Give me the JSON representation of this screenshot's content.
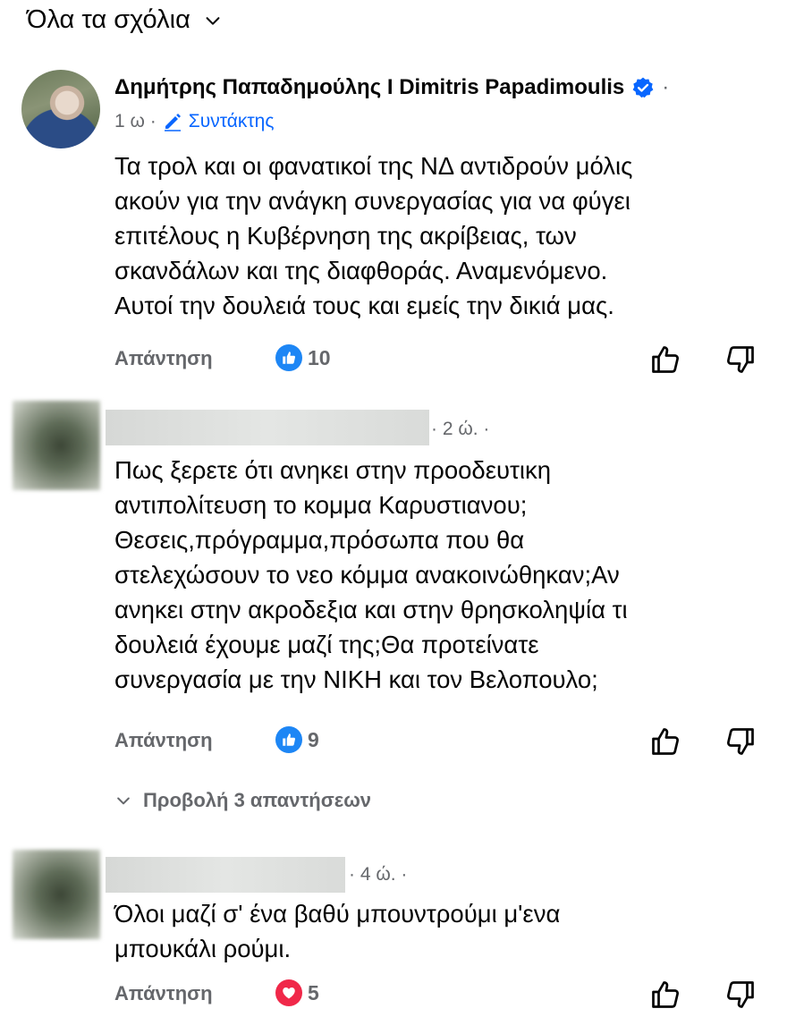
{
  "filter": {
    "label": "Όλα τα σχόλια",
    "icon": "chevron-down-icon"
  },
  "comments": [
    {
      "author": "Δημήτρης Παπαδημούλης I Dimitris Papadimoulis",
      "verified": true,
      "more": "·",
      "time": "1 ω ·",
      "role": "Συντάκτης",
      "lines": [
        "Τα τρολ και οι φανατικοί της ΝΔ αντιδρούν μόλις",
        "ακούν για την ανάγκη συνεργασίας για να φύγει",
        "επιτέλους η Κυβέρνηση της ακρίβειας, των",
        "σκανδάλων και της διαφθοράς. Αναμενόμενο.",
        "Αυτοί την δουλειά τους και εμείς την δικιά μας."
      ],
      "reply_label": "Απάντηση",
      "reaction": {
        "type": "like",
        "count": "10"
      }
    },
    {
      "time": "· 2 ώ. ·",
      "lines": [
        "Πως ξερετε ότι ανηκει στην προοδευτικη",
        "αντιπολίτευση το κομμα  Καρυστιανου;",
        "Θεσεις,πρόγραμμα,πρόσωπα που θα",
        "στελεχώσουν το νεο κόμμα ανακοινώθηκαν;Αν",
        "ανηκει στην ακροδεξια και στην θρησκοληψία τι",
        "δουλειά έχουμε μαζί της;Θα προτείνατε",
        "συνεργασία με την ΝΙΚΗ και τον Βελοπουλο;"
      ],
      "reply_label": "Απάντηση",
      "reaction": {
        "type": "like",
        "count": "9"
      },
      "view_replies": "Προβολή 3 απαντήσεων"
    },
    {
      "time": "· 4 ώ. ·",
      "lines": [
        "Όλοι μαζί σ' ένα βαθύ μπουντρούμι μ'ενα",
        "μπουκάλι ρούμι."
      ],
      "reply_label": "Απάντηση",
      "reaction": {
        "type": "love",
        "count": "5"
      }
    }
  ],
  "colors": {
    "like": "#1d86f5",
    "love": "#f02849",
    "verified": "#0866ff",
    "secondary_text": "#65676b"
  }
}
